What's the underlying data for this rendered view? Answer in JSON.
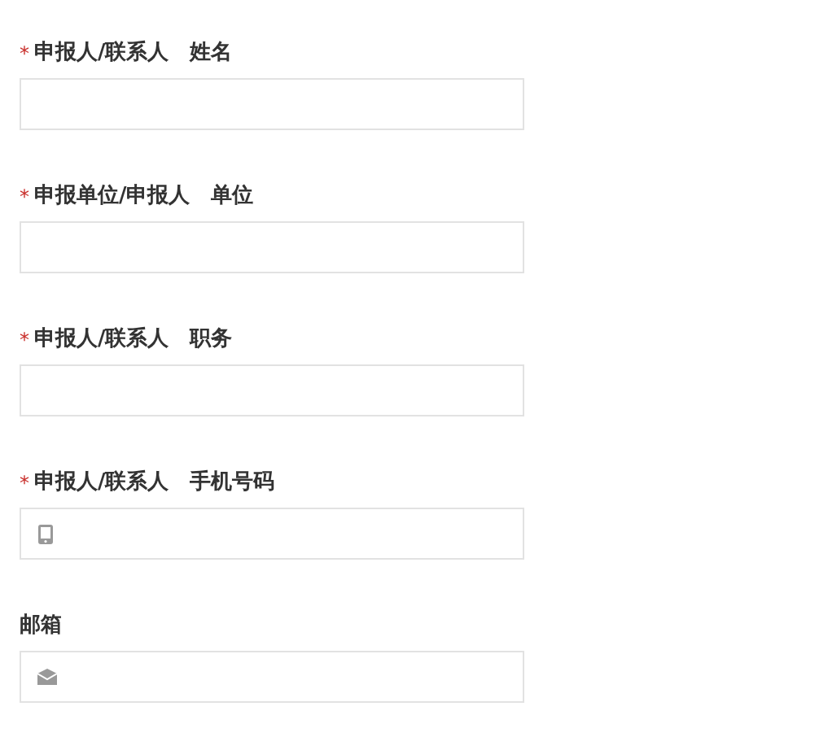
{
  "fields": [
    {
      "required_mark": "*",
      "label": "申报人/联系人　姓名",
      "kind": "text"
    },
    {
      "required_mark": "*",
      "label": "申报单位/申报人　单位",
      "kind": "text"
    },
    {
      "required_mark": "*",
      "label": "申报人/联系人　职务",
      "kind": "text"
    },
    {
      "required_mark": "*",
      "label": "申报人/联系人　手机号码",
      "kind": "phone"
    },
    {
      "label": "邮箱",
      "kind": "mail"
    }
  ]
}
